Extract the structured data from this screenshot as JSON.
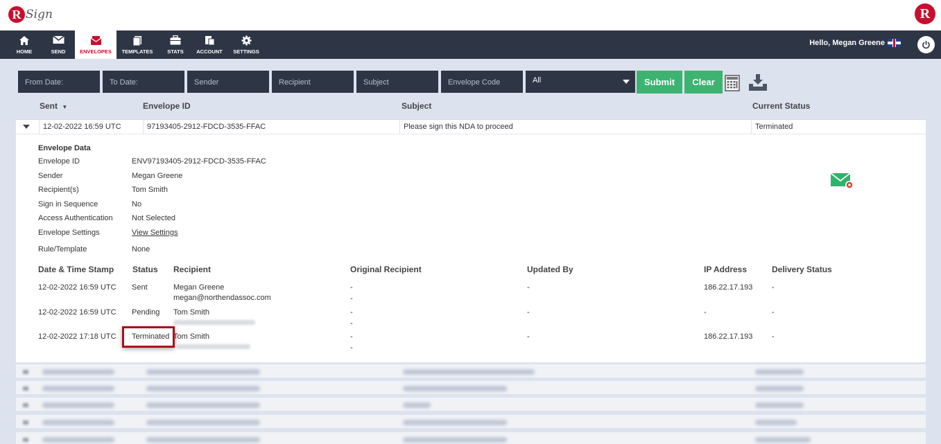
{
  "app": {
    "logo_letter": "R",
    "logo_text": "Sign",
    "brand_color": "#c8102e"
  },
  "nav": {
    "items": [
      {
        "label": "HOME",
        "icon": "home-icon"
      },
      {
        "label": "SEND",
        "icon": "envelope-icon"
      },
      {
        "label": "ENVELOPES",
        "icon": "envelopes-icon"
      },
      {
        "label": "TEMPLATES",
        "icon": "templates-icon"
      },
      {
        "label": "STATS",
        "icon": "briefcase-icon"
      },
      {
        "label": "ACCOUNT",
        "icon": "account-icon"
      },
      {
        "label": "SETTINGS",
        "icon": "gear-icon"
      }
    ],
    "active": "ENVELOPES",
    "greeting": "Hello, Megan Greene"
  },
  "filters": {
    "from_date": "From Date:",
    "to_date": "To Date:",
    "sender": "Sender",
    "recipient": "Recipient",
    "subject": "Subject",
    "envelope_code": "Envelope Code",
    "status_selected": "All",
    "submit": "Submit",
    "clear": "Clear"
  },
  "columns": {
    "sent": "Sent",
    "envelope_id": "Envelope ID",
    "subject": "Subject",
    "current_status": "Current Status"
  },
  "envelope": {
    "sent": "12-02-2022 16:59 UTC",
    "envelope_id": "97193405-2912-FDCD-3535-FFAC",
    "subject": "Please sign this NDA to proceed",
    "status": "Terminated"
  },
  "envelope_data": {
    "title": "Envelope Data",
    "fields": [
      {
        "label": "Envelope ID",
        "value": "ENV97193405-2912-FDCD-3535-FFAC"
      },
      {
        "label": "Sender",
        "value": "Megan Greene"
      },
      {
        "label": "Recipient(s)",
        "value": "Tom Smith"
      },
      {
        "label": "Sign in Sequence",
        "value": "No"
      },
      {
        "label": "Access Authentication",
        "value": "Not Selected"
      },
      {
        "label": "Envelope Settings",
        "value": "View Settings"
      },
      {
        "label": "Rule/Template",
        "value": "None"
      }
    ]
  },
  "history": {
    "headers": [
      "Date & Time Stamp",
      "Status",
      "Recipient",
      "Original Recipient",
      "Updated By",
      "IP Address",
      "Delivery Status"
    ],
    "rows": [
      {
        "date": "12-02-2022 16:59 UTC",
        "status": "Sent",
        "recipient": "Megan Greene",
        "recipient_email": "megan@northendassoc.com",
        "original1": "-",
        "original2": "-",
        "updated_by": "-",
        "ip": "186.22.17.193",
        "delivery": "-"
      },
      {
        "date": "12-02-2022 16:59 UTC",
        "status": "Pending",
        "recipient": "Tom Smith",
        "recipient_email": "",
        "original1": "-",
        "original2": "-",
        "updated_by": "-",
        "ip": "-",
        "delivery": "-"
      },
      {
        "date": "12-02-2022 17:18 UTC",
        "status": "Terminated",
        "recipient": "Tom Smith",
        "recipient_email": "",
        "original1": "-",
        "original2": "-",
        "updated_by": "-",
        "ip": "186.22.17.193",
        "delivery": "-"
      }
    ]
  }
}
